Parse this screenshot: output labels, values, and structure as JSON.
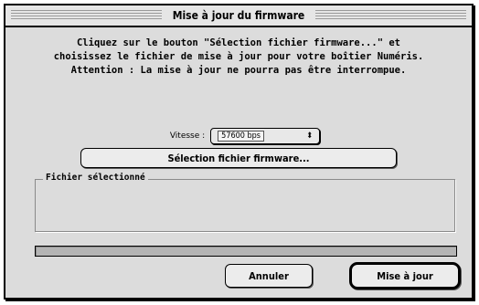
{
  "dialog": {
    "title": "Mise à jour du firmware",
    "instructions": [
      "Cliquez sur le bouton \"Sélection fichier firmware...\" et",
      "choisissez le fichier de mise à jour pour votre boîtier Numéris.",
      "Attention : La mise à jour ne pourra pas être interrompue."
    ],
    "speed": {
      "label": "Vitesse :",
      "selected": "57600 bps",
      "arrow_icon": "up-down-arrows-icon"
    },
    "select_file_button": "Sélection fichier firmware...",
    "selected_file": {
      "label": "Fichier sélectionné",
      "value": ""
    },
    "progress": {
      "fraction": 0
    },
    "buttons": {
      "cancel": "Annuler",
      "update": "Mise à jour"
    }
  }
}
